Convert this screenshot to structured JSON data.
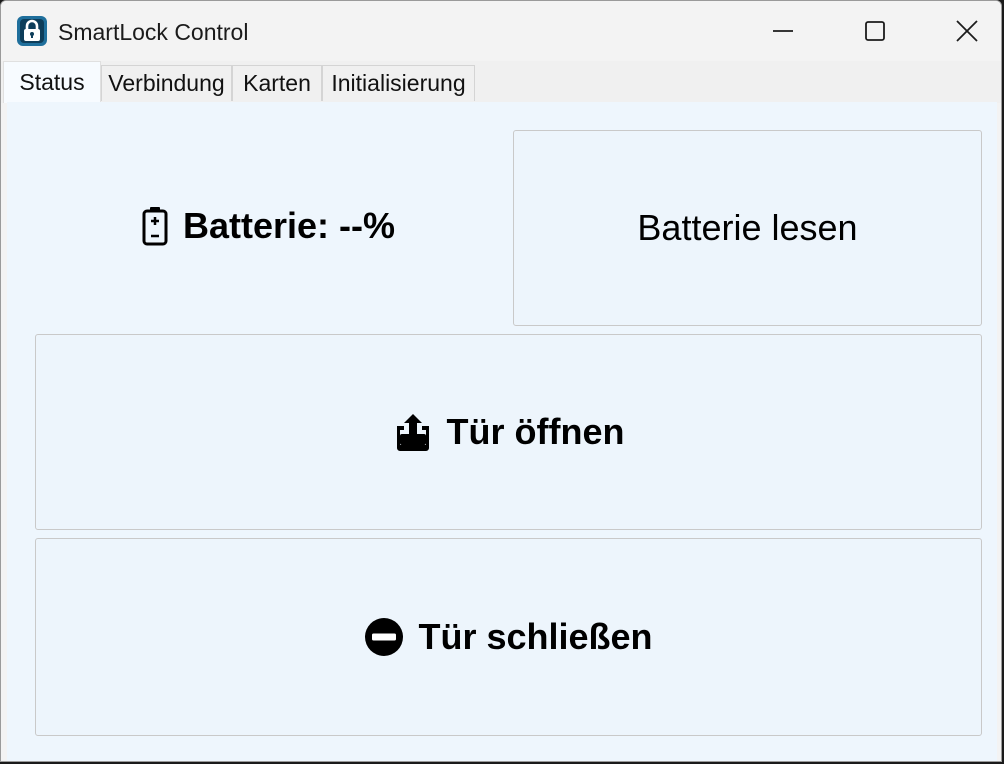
{
  "window": {
    "title": "SmartLock Control",
    "icons": {
      "app": "padlock-app-icon",
      "minimize": "minimize-icon",
      "maximize": "maximize-icon",
      "close": "close-icon"
    }
  },
  "tabs": [
    {
      "label": "Status",
      "active": true
    },
    {
      "label": "Verbindung",
      "active": false
    },
    {
      "label": "Karten",
      "active": false
    },
    {
      "label": "Initialisierung",
      "active": false
    }
  ],
  "status": {
    "battery_label": "Batterie: --%",
    "battery_icon": "battery-icon",
    "read_battery_button": "Batterie lesen",
    "open_door_button": "Tür öffnen",
    "open_door_icon": "unlock-tray-icon",
    "close_door_button": "Tür schließen",
    "close_door_icon": "no-entry-icon"
  },
  "colors": {
    "panel_background": "#eef6fd",
    "app_icon_background": "#1f6f9c"
  }
}
